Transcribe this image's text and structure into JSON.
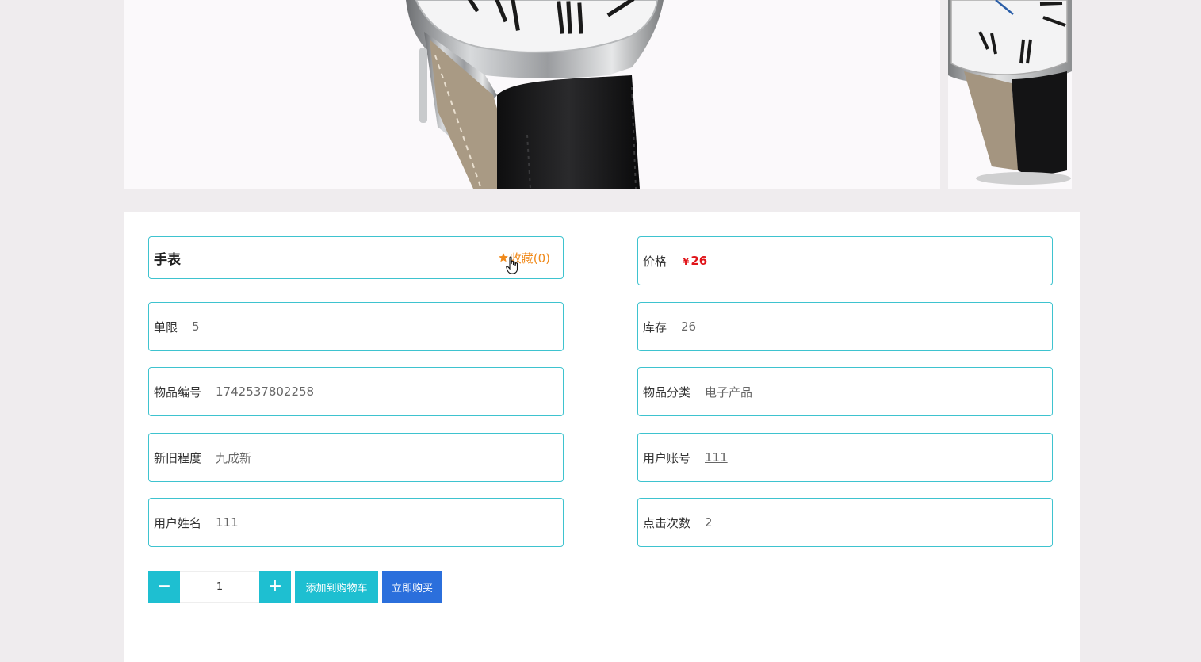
{
  "product": {
    "name": "手表",
    "favorite_label": "收藏(0)"
  },
  "price": {
    "label": "价格",
    "currency": "¥",
    "value": "26"
  },
  "fields": {
    "limit": {
      "label": "单限",
      "value": "5"
    },
    "stock": {
      "label": "库存",
      "value": "26"
    },
    "item_no": {
      "label": "物品编号",
      "value": "1742537802258"
    },
    "category": {
      "label": "物品分类",
      "value": "电子产品"
    },
    "condition": {
      "label": "新旧程度",
      "value": "九成新"
    },
    "user_account": {
      "label": "用户账号",
      "value": "111"
    },
    "user_name": {
      "label": "用户姓名",
      "value": "111"
    },
    "clicks": {
      "label": "点击次数",
      "value": "2"
    }
  },
  "actions": {
    "minus": "−",
    "quantity": "1",
    "plus": "+",
    "add_to_cart": "添加到购物车",
    "buy_now": "立即购买"
  },
  "colors": {
    "accent": "#1ebfd1",
    "border": "#3ec3cf",
    "buy": "#2b6fdc",
    "price": "#e0151a",
    "favorite": "#f08a1b"
  },
  "icons": {
    "favorite": "star-icon",
    "cursor": "hand-cursor-icon"
  }
}
